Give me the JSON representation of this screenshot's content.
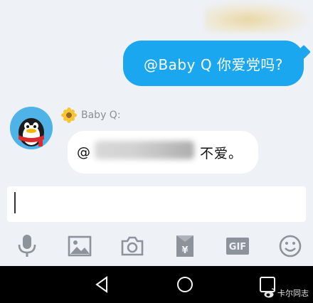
{
  "chat": {
    "outgoing_message": "@Baby Q 你爱党吗?",
    "bot_name": "Baby Q:",
    "reply_at": "@",
    "reply_text": "不爱。"
  },
  "input": {
    "value": "",
    "placeholder": ""
  },
  "toolbar": {
    "icons": [
      "microphone-icon",
      "image-icon",
      "camera-icon",
      "red-envelope-icon",
      "gif-icon",
      "emoji-icon"
    ],
    "gif_label": "GIF",
    "red_envelope_glyph": "¥"
  },
  "watermark": {
    "text": "卡尔同志"
  },
  "colors": {
    "accent_blue": "#1aa7ef",
    "chat_bg": "#eef1f5",
    "icon_gray": "#8d939b",
    "nav_bg": "#000000"
  }
}
